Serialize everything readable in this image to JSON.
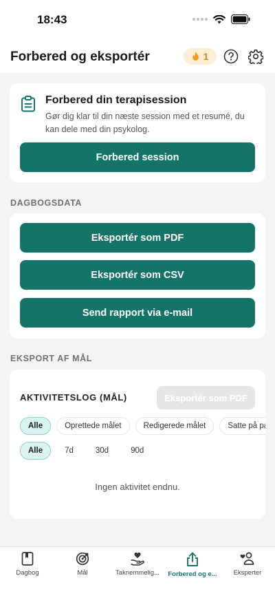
{
  "status": {
    "time": "18:43"
  },
  "header": {
    "title": "Forbered og eksportér",
    "streak_count": "1"
  },
  "prep_card": {
    "title": "Forbered din terapisession",
    "description": "Gør dig klar til din næste session med et resumé, du kan dele med din psykolog.",
    "button_label": "Forbered session"
  },
  "diary_section": {
    "label": "DAGBOGSDATA",
    "buttons": [
      "Eksportér som PDF",
      "Eksportér som CSV",
      "Send rapport via e-mail"
    ]
  },
  "goal_section": {
    "label": "EKSPORT AF MÅL",
    "activity_title": "AKTIVITETSLOG (MÅL)",
    "export_pdf_label": "Eksportér som PDF",
    "type_filters": [
      "Alle",
      "Oprettede målet",
      "Redigerede målet",
      "Satte på pa"
    ],
    "period_filters": [
      "Alle",
      "7d",
      "30d",
      "90d"
    ],
    "empty_text": "Ingen aktivitet endnu."
  },
  "tabs": [
    {
      "label": "Dagbog",
      "icon": "book-icon"
    },
    {
      "label": "Mål",
      "icon": "target-icon"
    },
    {
      "label": "Taknemmelig...",
      "icon": "heart-hand-icon"
    },
    {
      "label": "Forbered og e...",
      "icon": "share-icon",
      "active": true
    },
    {
      "label": "Eksperter",
      "icon": "people-icon"
    }
  ],
  "colors": {
    "primary": "#147468",
    "chip_active_bg": "#d9f3ee",
    "streak_bg": "#fbeed3"
  }
}
